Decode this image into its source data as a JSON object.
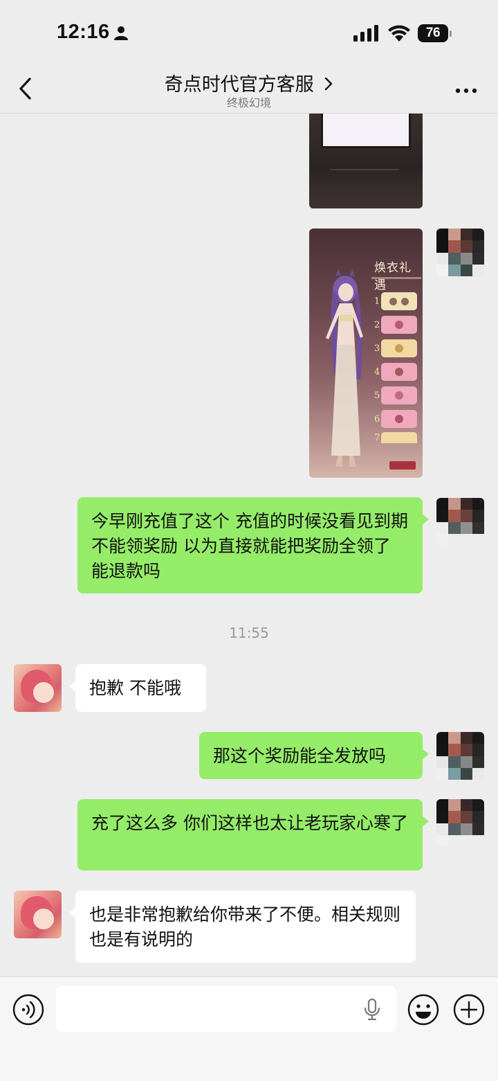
{
  "status_bar": {
    "time": "12:16",
    "battery": "76"
  },
  "header": {
    "title": "奇点时代官方客服",
    "subtitle": "终极幻境"
  },
  "messages": {
    "m1_text": "今早刚充值了这个 充值的时候没看见到期不能领奖励 以为直接就能把奖励全领了 能退款吗",
    "timestamp": "11:55",
    "m2_text": "抱歉 不能哦",
    "m3_text": "那这个奖励能全发放吗",
    "m4_text": "充了这么多 你们这样也太让老玩家心寒了",
    "m5_text": "也是非常抱歉给你带来了不便。相关规则也是有说明的"
  },
  "promo_image": {
    "title": "焕衣礼遇",
    "steps": [
      "1",
      "2",
      "3",
      "4",
      "5",
      "6",
      "7"
    ]
  },
  "colors": {
    "background": "#ededed",
    "my_bubble": "#95ec69",
    "their_bubble": "#ffffff"
  }
}
